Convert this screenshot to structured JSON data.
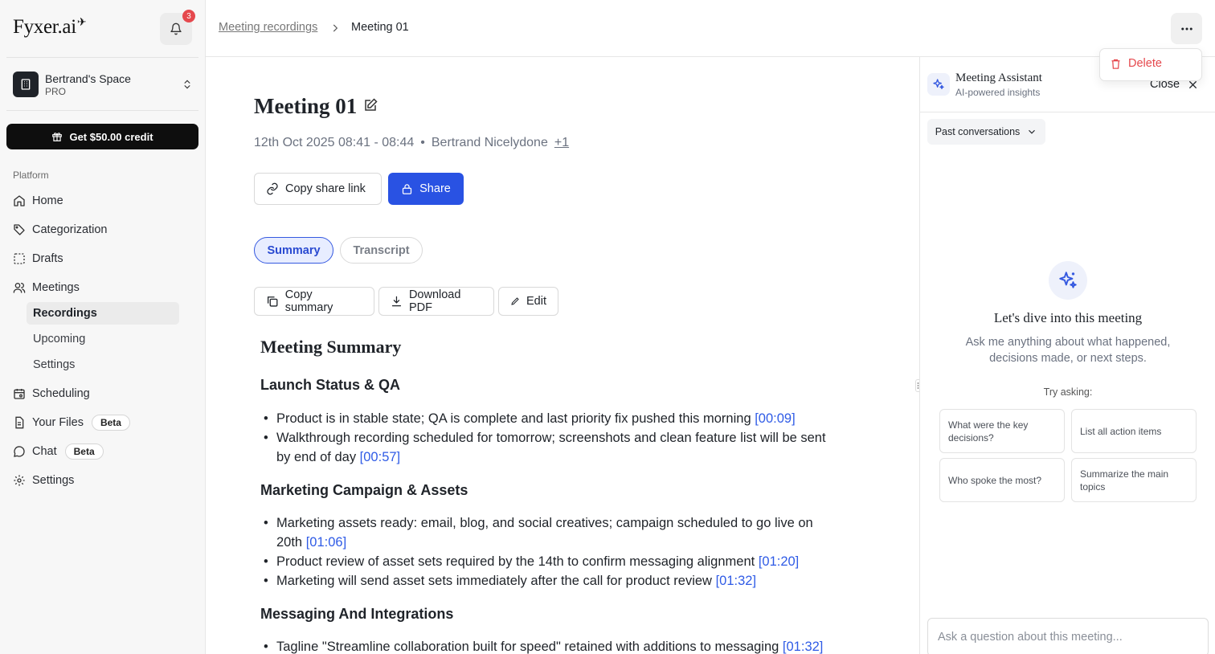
{
  "sidebar": {
    "logo": "Fyxer.ai",
    "notifications_count": "3",
    "space": {
      "name": "Bertrand's Space",
      "plan": "PRO"
    },
    "credit_button": "Get $50.00 credit",
    "section_label": "Platform",
    "items": [
      {
        "label": "Home",
        "icon": "home-icon"
      },
      {
        "label": "Categorization",
        "icon": "tag-icon"
      },
      {
        "label": "Drafts",
        "icon": "drafts-icon"
      },
      {
        "label": "Meetings",
        "icon": "users-icon"
      },
      {
        "label": "Scheduling",
        "icon": "calendar-icon"
      },
      {
        "label": "Your Files",
        "icon": "file-icon",
        "badge": "Beta"
      },
      {
        "label": "Chat",
        "icon": "chat-icon",
        "badge": "Beta"
      },
      {
        "label": "Settings",
        "icon": "gear-icon"
      }
    ],
    "meetings_sub": [
      {
        "label": "Recordings",
        "active": true
      },
      {
        "label": "Upcoming"
      },
      {
        "label": "Settings"
      }
    ]
  },
  "topbar": {
    "breadcrumb_parent": "Meeting recordings",
    "breadcrumb_current": "Meeting 01",
    "menu": {
      "delete": "Delete"
    }
  },
  "meeting": {
    "title": "Meeting 01",
    "datetime": "12th Oct 2025 08:41 - 08:44",
    "separator": "•",
    "attendee": "Bertrand Nicelydone",
    "more_attendees": "+1",
    "copy_link": "Copy share link",
    "share": "Share",
    "tabs": {
      "summary": "Summary",
      "transcript": "Transcript"
    },
    "actions": {
      "copy_summary": "Copy summary",
      "download_pdf": "Download PDF",
      "edit": "Edit"
    }
  },
  "summary": {
    "title": "Meeting Summary",
    "sections": [
      {
        "heading": "Launch Status & QA",
        "bullets": [
          {
            "text": "Product is in stable state; QA is complete and last priority fix pushed this morning",
            "ts": "[00:09]"
          },
          {
            "text": "Walkthrough recording scheduled for tomorrow; screenshots and clean feature list will be sent by end of day",
            "ts": "[00:57]"
          }
        ]
      },
      {
        "heading": "Marketing Campaign & Assets",
        "bullets": [
          {
            "text": "Marketing assets ready: email, blog, and social creatives; campaign scheduled to go live on 20th",
            "ts": "[01:06]"
          },
          {
            "text": "Product review of asset sets required by the 14th to confirm messaging alignment",
            "ts": "[01:20]"
          },
          {
            "text": "Marketing will send asset sets immediately after the call for product review",
            "ts": "[01:32]"
          }
        ]
      },
      {
        "heading": "Messaging And Integrations",
        "bullets": [
          {
            "text": "Tagline \"Streamline collaboration built for speed\" retained with additions to messaging",
            "ts": "[01:32]"
          }
        ]
      }
    ]
  },
  "assistant": {
    "title": "Meeting Assistant",
    "subtitle": "AI-powered insights",
    "close": "Close",
    "past_conversations": "Past conversations",
    "empty_title": "Let's dive into this meeting",
    "empty_sub": "Ask me anything about what happened, decisions made, or next steps.",
    "try_asking": "Try asking:",
    "suggestions": [
      "What were the key decisions?",
      "List all action items",
      "Who spoke the most?",
      "Summarize the main topics"
    ],
    "input_placeholder": "Ask a question about this meeting..."
  },
  "colors": {
    "accent": "#2952e3",
    "danger": "#e5484d",
    "link": "#2f5be6"
  }
}
